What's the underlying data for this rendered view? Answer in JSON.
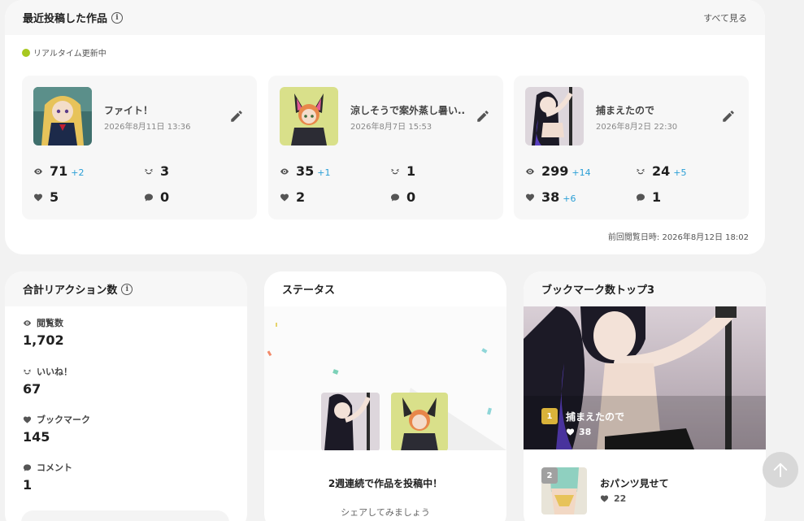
{
  "recent": {
    "title": "最近投稿した作品",
    "see_all": "すべて見る",
    "live_label": "リアルタイム更新中",
    "last_view": "前回閲覧日時: 2026年8月12日 18:02",
    "works": [
      {
        "title": "ファイト！",
        "date": "2026年8月11日 13:36",
        "views": "71",
        "views_delta": "+2",
        "likes": "3",
        "likes_delta": "",
        "bookmarks": "5",
        "bookmarks_delta": "",
        "comments": "0"
      },
      {
        "title": "涼しそうで案外蒸し暑い...",
        "date": "2026年8月7日 15:53",
        "views": "35",
        "views_delta": "+1",
        "likes": "1",
        "likes_delta": "",
        "bookmarks": "2",
        "bookmarks_delta": "",
        "comments": "0"
      },
      {
        "title": "捕まえたので",
        "date": "2026年8月2日 22:30",
        "views": "299",
        "views_delta": "+14",
        "likes": "24",
        "likes_delta": "+5",
        "bookmarks": "38",
        "bookmarks_delta": "+6",
        "comments": "1"
      }
    ]
  },
  "totals": {
    "title": "合計リアクション数",
    "views_label": "閲覧数",
    "views": "1,702",
    "likes_label": "いいね！",
    "likes": "67",
    "bookmarks_label": "ブックマーク",
    "bookmarks": "145",
    "comments_label": "コメント",
    "comments": "1"
  },
  "status": {
    "title": "ステータス",
    "message": "2週連続で作品を投稿中！",
    "sub": "シェアしてみましょう"
  },
  "bookmark_top": {
    "title": "ブックマーク数トップ3",
    "items": [
      {
        "rank": "1",
        "title": "捕まえたので",
        "count": "38"
      },
      {
        "rank": "2",
        "title": "おパンツ見せて",
        "count": "22"
      }
    ]
  },
  "colors": {
    "accent_blue": "#2a9fd6",
    "live_green": "#a7c820",
    "rank1": "#d9b23a",
    "rank2": "#a0a0a0"
  },
  "icons": [
    "info-icon",
    "eye-icon",
    "smile-icon",
    "heart-icon",
    "comment-icon",
    "pencil-icon",
    "arrow-up-icon"
  ]
}
